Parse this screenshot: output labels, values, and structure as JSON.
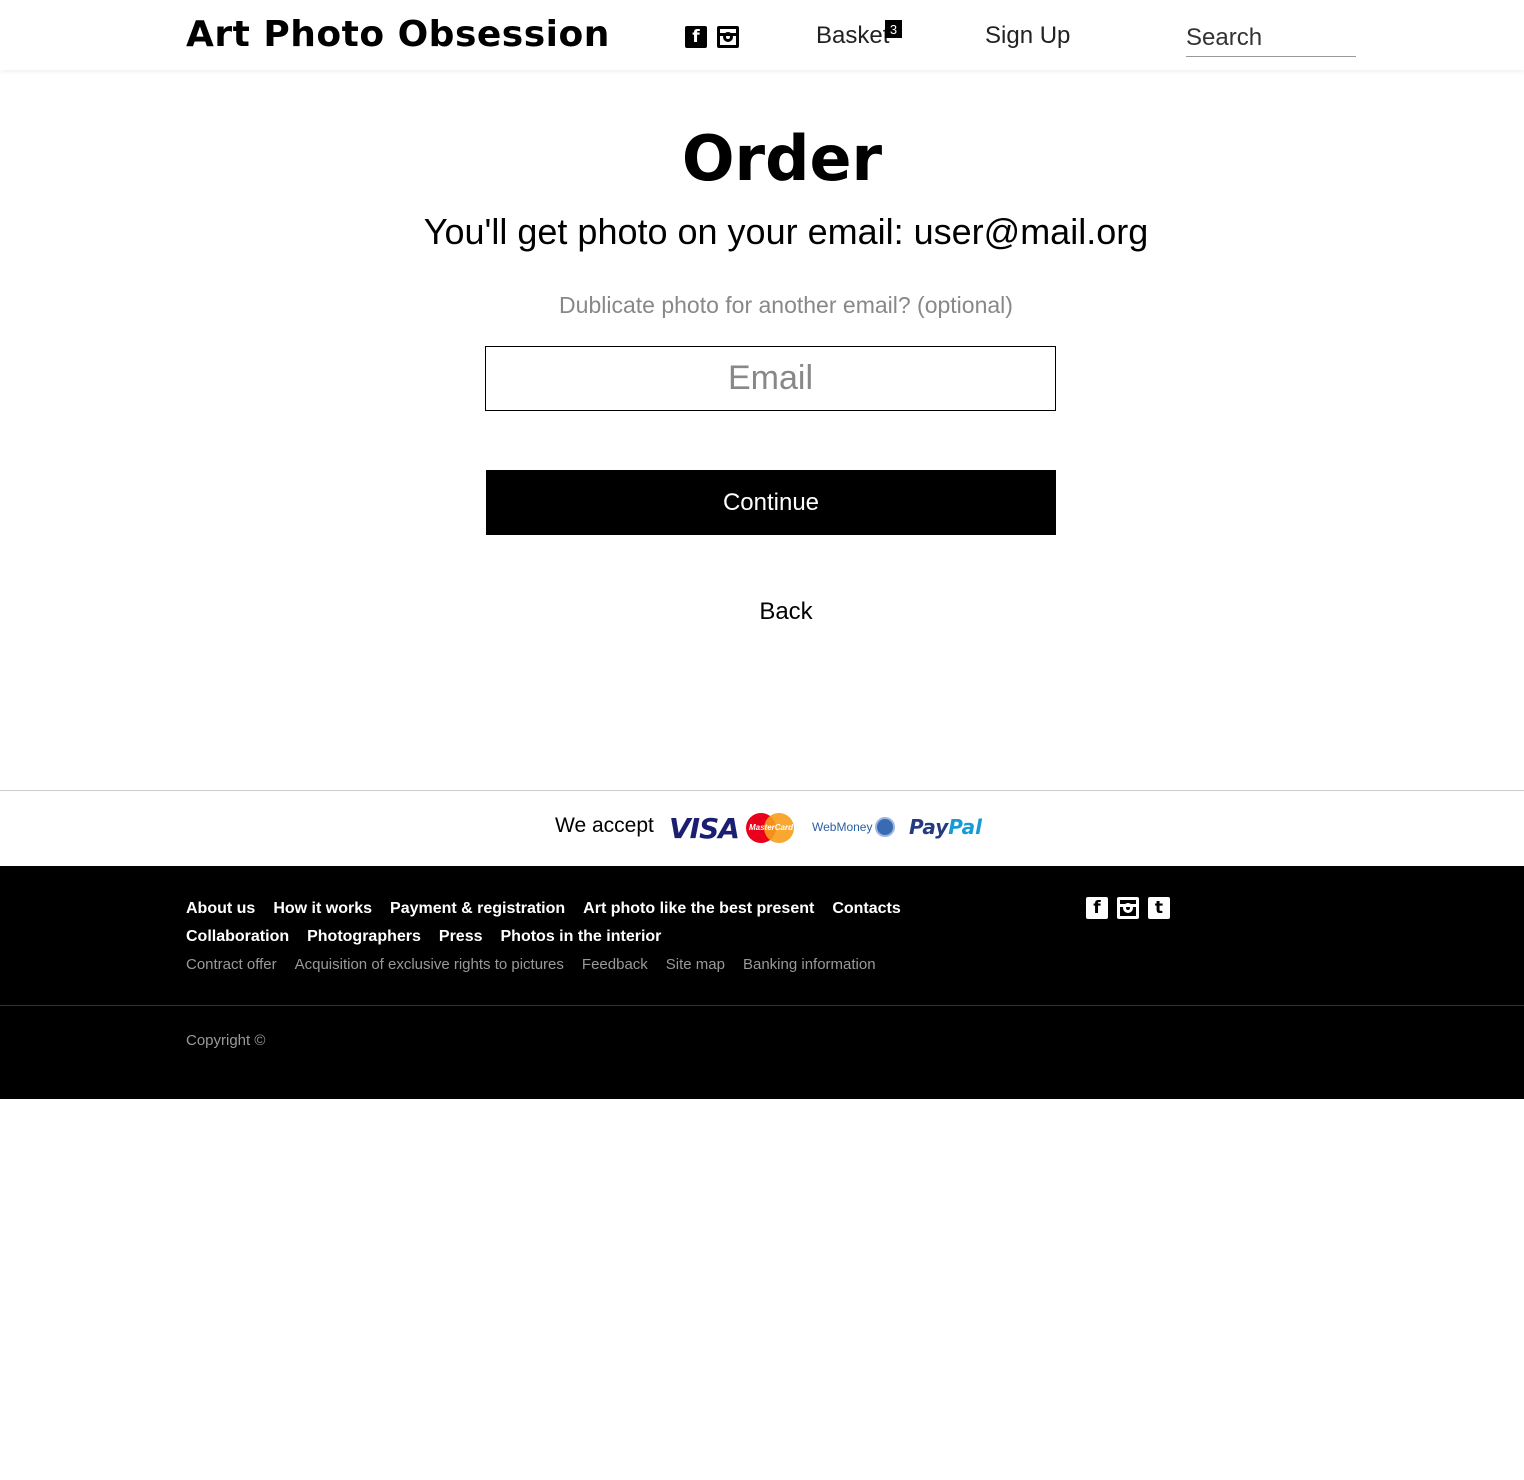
{
  "header": {
    "logo": "Art Photo Obsession",
    "social": {
      "facebook": "f",
      "instagram_icon": "instagram-icon"
    },
    "basket_label": "Basket",
    "basket_count": "3",
    "signup_label": "Sign Up",
    "search_placeholder": "Search"
  },
  "main": {
    "title": "Order",
    "subtitle": "You'll get photo on your email: user@mail.org",
    "hint": "Dublicate photo for another email? (optional)",
    "email_placeholder": "Email",
    "continue_label": "Continue",
    "back_label": "Back"
  },
  "payments": {
    "label": "We accept",
    "visa": "VISA",
    "mastercard": "MasterCard",
    "webmoney": "WebMoney",
    "paypal_a": "Pay",
    "paypal_b": "Pal"
  },
  "footer": {
    "row1": [
      "About us",
      "How it works",
      "Payment & registration",
      "Art photo like the best present",
      "Contacts"
    ],
    "row2": [
      "Collaboration",
      "Photographers",
      "Press",
      "Photos in the interior"
    ],
    "row3": [
      "Contract offer",
      "Acquisition of exclusive rights to pictures",
      "Feedback",
      "Site map",
      "Banking information"
    ],
    "social": {
      "facebook": "f",
      "tumblr": "t"
    },
    "copyright": "Copyright ©"
  }
}
